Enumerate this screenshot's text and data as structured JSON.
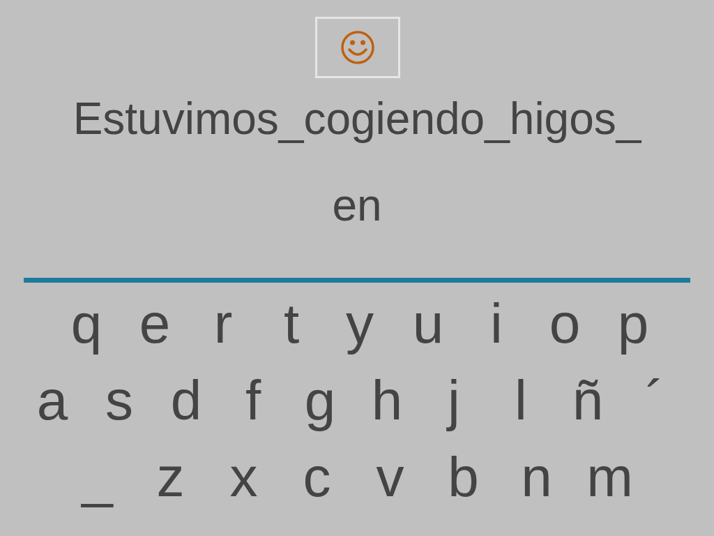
{
  "sentence": [
    "Estuvimos_cogiendo_higos_",
    "en"
  ],
  "keyboard": {
    "rows": [
      [
        "q",
        "e",
        "r",
        "t",
        "y",
        "u",
        "i",
        "o",
        "p"
      ],
      [
        "a",
        "s",
        "d",
        "f",
        "g",
        "h",
        "j",
        "l",
        "ñ",
        "´"
      ],
      [
        "_",
        "z",
        "x",
        "c",
        "v",
        "b",
        "n",
        "m"
      ]
    ]
  }
}
